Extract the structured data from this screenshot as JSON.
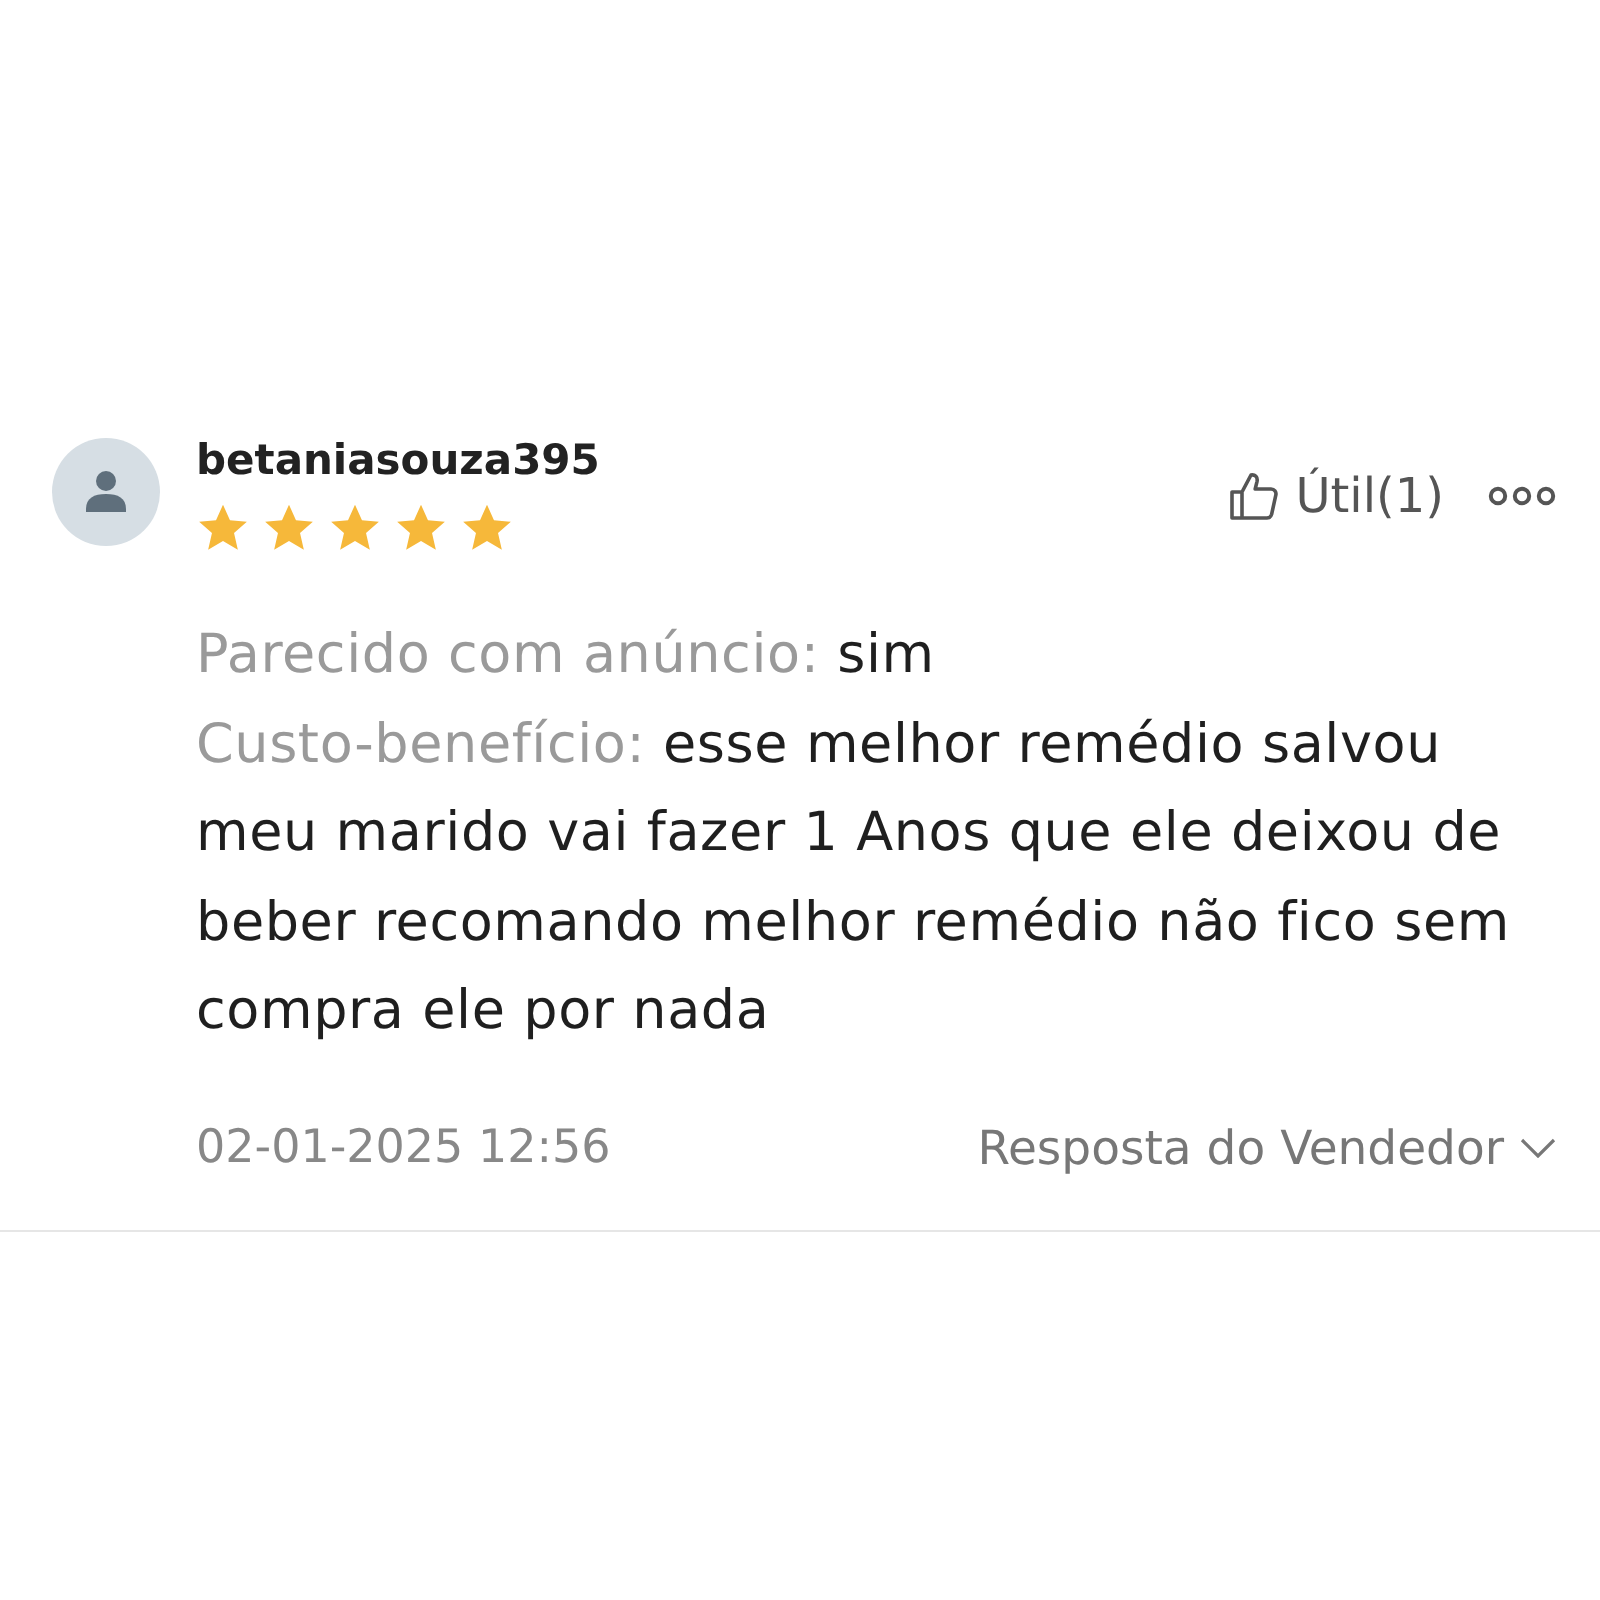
{
  "review": {
    "user": {
      "name": "betaniasouza395"
    },
    "stars": 5,
    "helpful": {
      "label": "Útil(1)"
    },
    "attributes": [
      {
        "label": "Parecido com anúncio:",
        "value": "sim"
      },
      {
        "label": "Custo-benefício:",
        "value": "esse melhor remédio salvou meu marido vai fazer 1 Anos que ele deixou de beber recomando melhor remédio não fico sem compra ele por nada"
      }
    ],
    "date": "02-01-2025 12:56",
    "seller_reply": {
      "label": "Resposta do Vendedor",
      "expanded": false
    }
  }
}
